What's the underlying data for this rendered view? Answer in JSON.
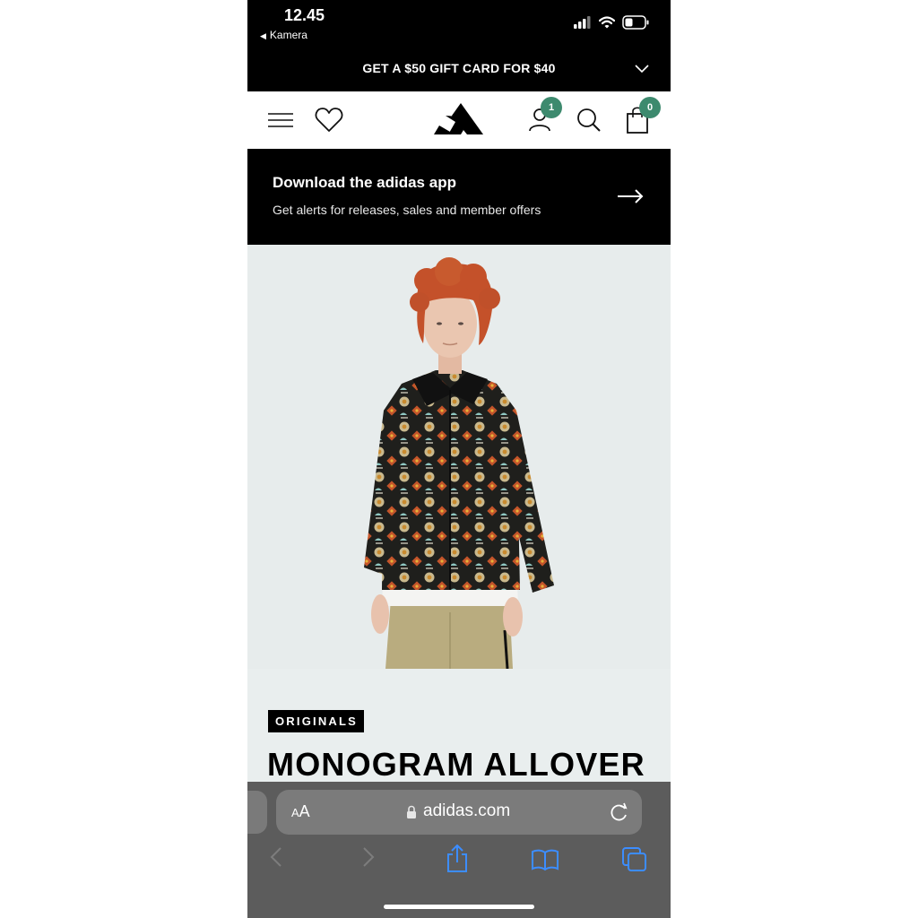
{
  "status_bar": {
    "time": "12.45",
    "back_app": "Kamera"
  },
  "promo_banner": {
    "text": "GET A $50 GIFT CARD FOR $40"
  },
  "nav": {
    "account_badge": "1",
    "cart_badge": "0",
    "badge_color": "#3d8a6e"
  },
  "app_banner": {
    "title": "Download the adidas app",
    "subtitle": "Get alerts for releases, sales and member offers"
  },
  "product": {
    "brand_label": "ORIGINALS",
    "title": "MONOGRAM ALLOVER"
  },
  "browser": {
    "text_size_small": "A",
    "text_size_big": "A",
    "url": "adidas.com"
  }
}
